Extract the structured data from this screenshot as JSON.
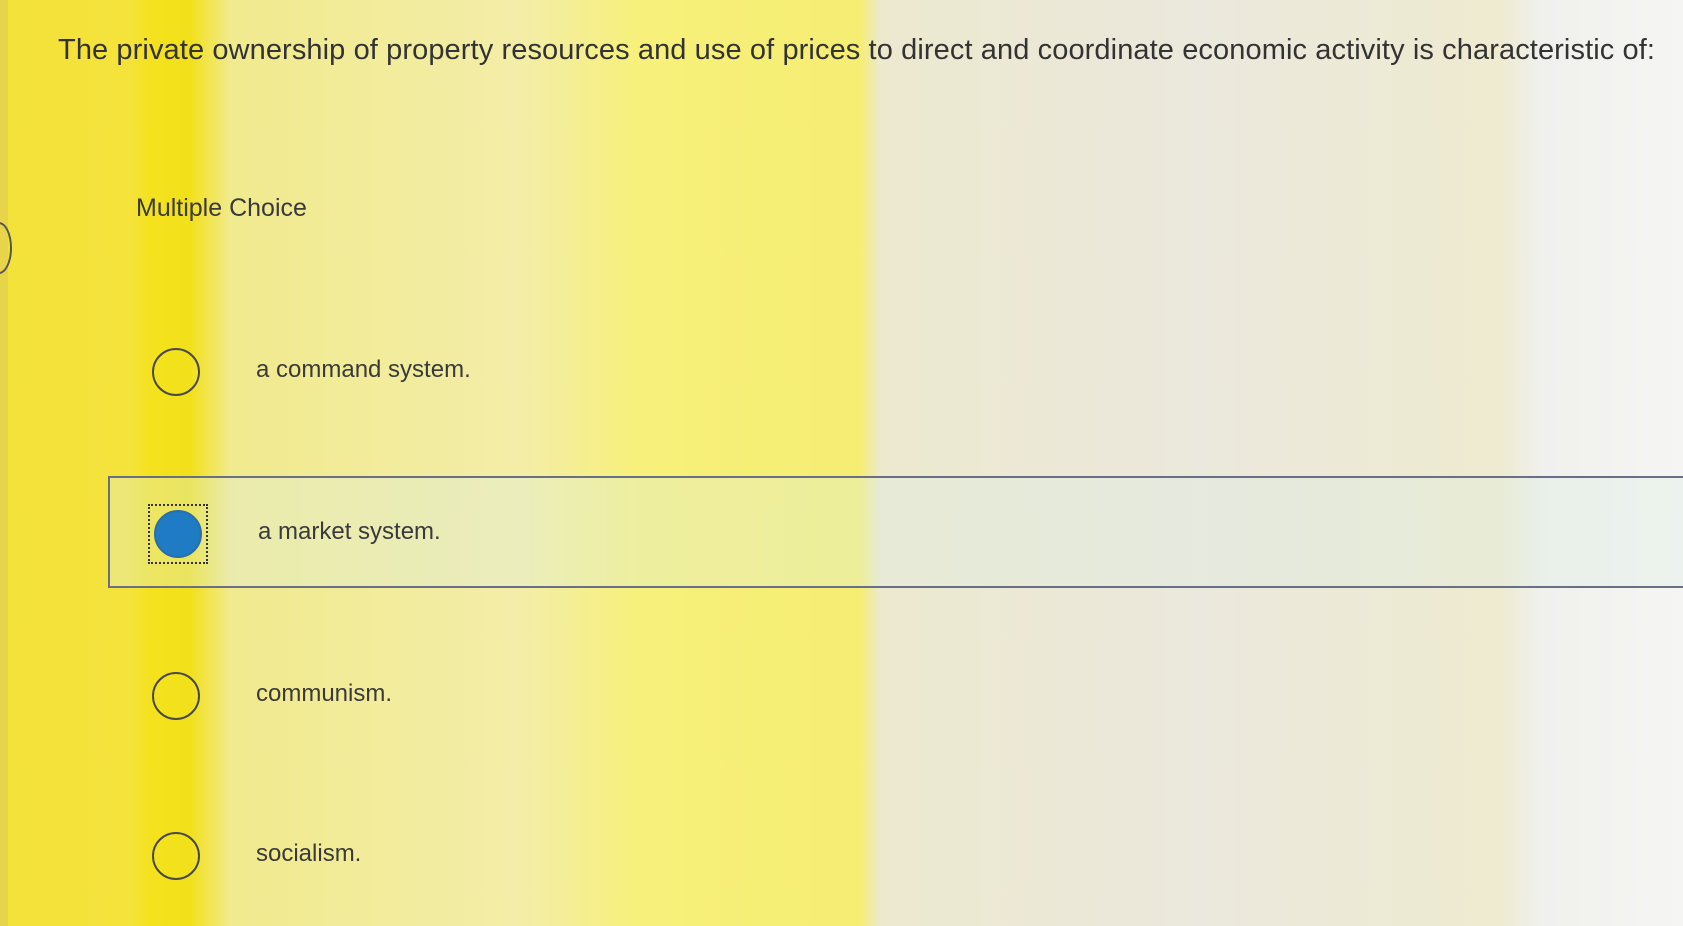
{
  "question": {
    "text": "The private ownership of property resources and use of prices to direct and coordinate economic activity is characteristic of:"
  },
  "choice_type_label": "Multiple Choice",
  "choices": [
    {
      "label": "a command system.",
      "selected": false
    },
    {
      "label": "a market system.",
      "selected": true
    },
    {
      "label": "communism.",
      "selected": false
    },
    {
      "label": "socialism.",
      "selected": false
    }
  ],
  "colors": {
    "selected_radio": "#1f7bc4",
    "selected_border": "#6b6f86"
  }
}
